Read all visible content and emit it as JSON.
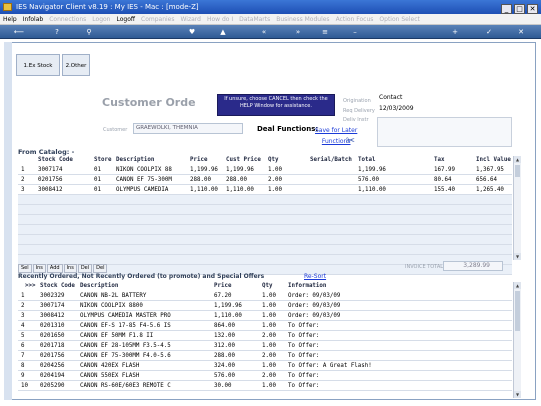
{
  "window": {
    "title": "IES Navigator Client v8.19 : My IES - Mac :       [mode-Z]",
    "controls": [
      "_",
      "□",
      "✕"
    ]
  },
  "menu": [
    {
      "label": "Help",
      "dim": false
    },
    {
      "label": "Infolab",
      "dim": false
    },
    {
      "label": "Connections",
      "dim": true
    },
    {
      "label": "Logon",
      "dim": true
    },
    {
      "label": "Logoff",
      "dim": false
    },
    {
      "label": "Companies",
      "dim": true
    },
    {
      "label": "Wizard",
      "dim": true
    },
    {
      "label": "How do I",
      "dim": true
    },
    {
      "label": "DataMarts",
      "dim": true
    },
    {
      "label": "Business Modules",
      "dim": true
    },
    {
      "label": "Action Focus",
      "dim": true
    },
    {
      "label": "Option Select",
      "dim": true
    }
  ],
  "toolbar_icons": [
    "back-icon",
    "help-icon",
    "search-icon",
    "heart-icon",
    "up-icon",
    "rewind-icon",
    "forward-icon",
    "list-icon",
    "minus-icon",
    "plus-icon",
    "check-icon",
    "close-icon"
  ],
  "tabs": [
    {
      "label": "1.Ex Stock"
    },
    {
      "label": "2.Other"
    }
  ],
  "form": {
    "title": "Customer Orde",
    "tip": "If unsure, choose CANCEL then check the HELP Window for assistance.",
    "origination_label": "Origination",
    "origination_value": "Contact",
    "req_delivery_label": "Req Delivery",
    "req_delivery_value": "12/03/2009",
    "delivery_instr_label": "Deliv Instr",
    "customer_label": "Customer",
    "customer_value": "GRAEWOLKI, THEMNIA",
    "deal_functions_label": "Deal Functions:",
    "save_for_later": "Save for Later",
    "functions": "Functions"
  },
  "catalog": {
    "section": "From Catalog: -",
    "columns": [
      "Stock Code",
      "Store",
      "Description",
      "Price",
      "Cust Price",
      "Qty",
      "Serial/Batch",
      "Total",
      "Tax",
      "Incl Value"
    ],
    "rows": [
      [
        "1",
        "3007174",
        "01",
        "NIKON COOLPIX 88",
        "1,199.96",
        "1,199.96",
        "1.00",
        "",
        "1,199.96",
        "167.99",
        "1,367.95"
      ],
      [
        "2",
        "0201756",
        "01",
        "CANON EF 75-300M",
        "288.00",
        "288.00",
        "2.00",
        "",
        "576.00",
        "80.64",
        "656.64"
      ],
      [
        "3",
        "3008412",
        "01",
        "OLYMPUS CAMEDIA",
        "1,110.00",
        "1,110.00",
        "1.00",
        "",
        "1,110.00",
        "155.40",
        "1,265.40"
      ]
    ],
    "empty_rows": 8,
    "row_tabs": [
      "Sel",
      "Ins",
      "Add",
      "Ins",
      "Del",
      "Del"
    ],
    "invoice_total_label": "INVOICE TOTAL",
    "invoice_total": "3,289.99"
  },
  "recent": {
    "section": "Recently Ordered, Not Recently Ordered (to promote) and Special Offers",
    "resort": "Re-Sort",
    "columns": [
      ">>>",
      "Stock Code",
      "Description",
      "Price",
      "Qty",
      "Information"
    ],
    "rows": [
      [
        "1",
        "3002329",
        "CANON NB-2L BATTERY",
        "67.20",
        "1.00",
        "Order: 09/03/09"
      ],
      [
        "2",
        "3007174",
        "NIKON COOLPIX 8800",
        "1,199.96",
        "1.00",
        "Order: 09/03/09"
      ],
      [
        "3",
        "3008412",
        "OLYMPUS CAMEDIA MASTER PRO",
        "1,110.00",
        "1.00",
        "Order: 09/03/09"
      ],
      [
        "4",
        "0201310",
        "CANON EF-S 17-85 F4-5.6 IS",
        "864.00",
        "1.00",
        "To Offer:"
      ],
      [
        "5",
        "0201650",
        "CANON EF 50MM F1.8 II",
        "132.00",
        "2.00",
        "To Offer:"
      ],
      [
        "6",
        "0201718",
        "CANON EF 28-105MM F3.5-4.5",
        "312.00",
        "1.00",
        "To Offer:"
      ],
      [
        "7",
        "0201756",
        "CANON EF 75-300MM F4.0-5.6",
        "288.00",
        "2.00",
        "To Offer:"
      ],
      [
        "8",
        "0204256",
        "CANON 420EX FLASH",
        "324.00",
        "1.00",
        "To Offer: A Great Flash!"
      ],
      [
        "9",
        "0204194",
        "CANON 550EX FLASH",
        "576.00",
        "2.00",
        "To Offer:"
      ],
      [
        "10",
        "0205290",
        "CANON RS-60E/60E3 REMOTE C",
        "30.00",
        "1.00",
        "To Offer:"
      ]
    ]
  },
  "colors": {
    "titlebar": "#2a60c4",
    "toolbar": "#3f6aa4",
    "tip_bg": "#2a2a8a",
    "link": "#1a3ad8"
  }
}
